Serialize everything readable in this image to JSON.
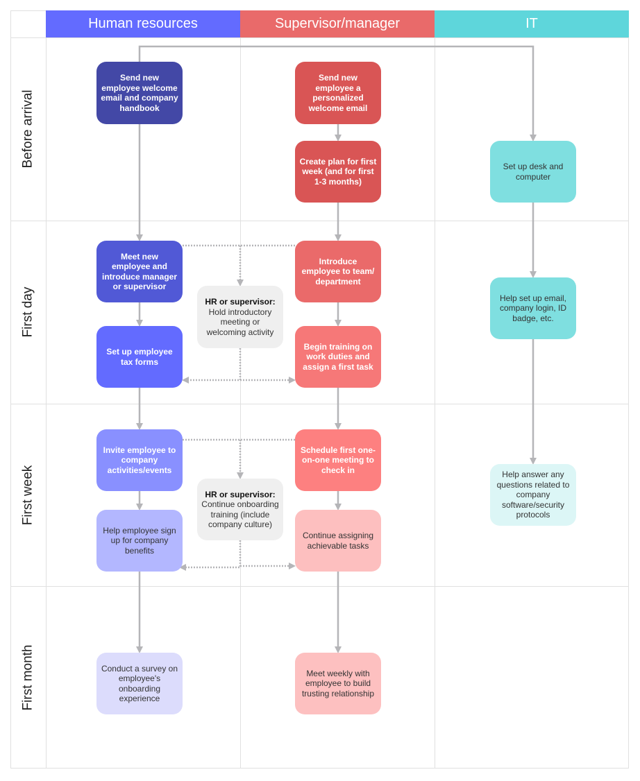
{
  "lanes": [
    {
      "label": "Human resources",
      "color": "#636bff"
    },
    {
      "label": "Supervisor/manager",
      "color": "#e96a6a"
    },
    {
      "label": "IT",
      "color": "#5ed6db"
    }
  ],
  "phases": [
    "Before arrival",
    "First day",
    "First week",
    "First month"
  ],
  "hr": [
    "Send new employee welcome email and company handbook",
    "Meet new employee and introduce manager or supervisor",
    "Set up employee tax forms",
    "Invite employee to company activities/events",
    "Help employee sign up for company benefits",
    "Conduct a survey on employee's onboarding experience"
  ],
  "sup": [
    "Send new employee a personalized welcome email",
    "Create plan for first week (and for first 1-3 months)",
    "Introduce employee to team/ department",
    "Begin training on work duties and assign a first task",
    "Schedule first one-on-one meeting to check in",
    "Continue assigning achievable tasks",
    "Meet weekly with employee to build trusting relationship"
  ],
  "shared": [
    {
      "title": "HR or supervisor:",
      "text": "Hold introductory meeting or welcoming activity"
    },
    {
      "title": "HR or supervisor:",
      "text": "Continue onboarding training (include company culture)"
    }
  ],
  "it": [
    "Set up desk and computer",
    "Help set up email, company login, ID badge, etc.",
    "Help answer any questions related to company software/security protocols"
  ]
}
